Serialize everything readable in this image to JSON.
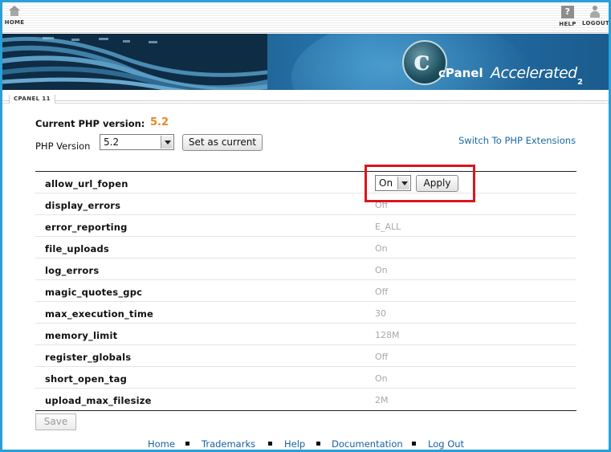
{
  "topbar": {
    "home_label": "HOME",
    "help_label": "HELP",
    "help_glyph": "?",
    "logout_label": "LOGOUT"
  },
  "banner": {
    "logo_glyph": "c",
    "brand_name": "cPanel",
    "brand_suffix": "Accelerated",
    "brand_version": "2"
  },
  "breadcrumb": "CPANEL 11",
  "php": {
    "current_label": "Current PHP version:",
    "current_value": "5.2",
    "version_label": "PHP Version",
    "version_selected": "5.2",
    "set_current_label": "Set as current",
    "switch_link": "Switch To PHP Extensions"
  },
  "settings": [
    {
      "name": "allow_url_fopen",
      "value": "On"
    },
    {
      "name": "display_errors",
      "value": "Off"
    },
    {
      "name": "error_reporting",
      "value": "E_ALL"
    },
    {
      "name": "file_uploads",
      "value": "On"
    },
    {
      "name": "log_errors",
      "value": "On"
    },
    {
      "name": "magic_quotes_gpc",
      "value": "Off"
    },
    {
      "name": "max_execution_time",
      "value": "30"
    },
    {
      "name": "memory_limit",
      "value": "128M"
    },
    {
      "name": "register_globals",
      "value": "Off"
    },
    {
      "name": "short_open_tag",
      "value": "On"
    },
    {
      "name": "upload_max_filesize",
      "value": "2M"
    }
  ],
  "editing": {
    "selected": "On",
    "apply_label": "Apply"
  },
  "save_label": "Save",
  "footer": {
    "links": [
      "Home",
      "Trademarks",
      "Help",
      "Documentation",
      "Log Out"
    ]
  },
  "colors": {
    "frame_border": "#2a9fd8",
    "version_accent": "#e8872a",
    "link": "#1a6aa0",
    "highlight": "#d9161c"
  }
}
